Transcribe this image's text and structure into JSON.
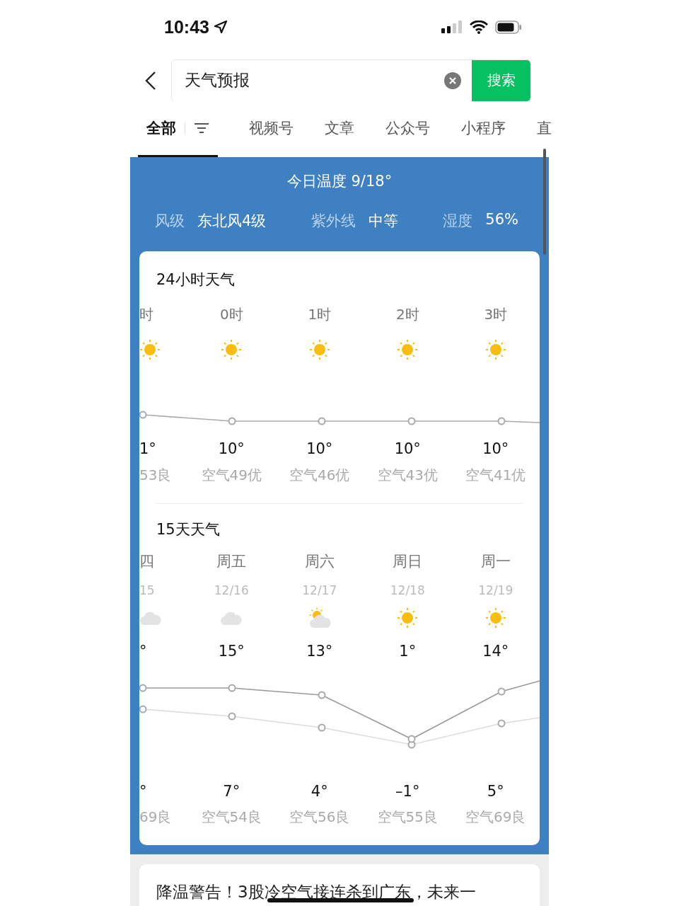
{
  "status_bar": {
    "time": "10:43"
  },
  "search": {
    "value": "天气预报",
    "button": "搜索"
  },
  "tabs": [
    {
      "label": "全部",
      "selected": true
    },
    {
      "label": "视频号",
      "selected": false
    },
    {
      "label": "文章",
      "selected": false
    },
    {
      "label": "公众号",
      "selected": false
    },
    {
      "label": "小程序",
      "selected": false
    },
    {
      "label": "直",
      "selected": false
    }
  ],
  "today": {
    "title": "今日温度 9/18°",
    "stats": [
      {
        "label": "风级",
        "value": "东北风4级"
      },
      {
        "label": "紫外线",
        "value": "中等"
      },
      {
        "label": "湿度",
        "value": "56%"
      }
    ]
  },
  "hourly": {
    "title": "24小时天气",
    "items": [
      {
        "time": "时",
        "kind": "sunny",
        "temp": "1°",
        "air": "53良"
      },
      {
        "time": "0时",
        "kind": "sunny",
        "temp": "10°",
        "air": "空气49优"
      },
      {
        "time": "1时",
        "kind": "sunny",
        "temp": "10°",
        "air": "空气46优"
      },
      {
        "time": "2时",
        "kind": "sunny",
        "temp": "10°",
        "air": "空气43优"
      },
      {
        "time": "3时",
        "kind": "sunny",
        "temp": "10°",
        "air": "空气41优"
      }
    ]
  },
  "daily": {
    "title": "15天天气",
    "items": [
      {
        "day": "四",
        "date": "15",
        "kind": "cloudy",
        "high": "°",
        "low": "°",
        "air": "69良"
      },
      {
        "day": "周五",
        "date": "12/16",
        "kind": "cloudy",
        "high": "15°",
        "low": "7°",
        "air": "空气54良"
      },
      {
        "day": "周六",
        "date": "12/17",
        "kind": "partly_cloudy",
        "high": "13°",
        "low": "4°",
        "air": "空气56良"
      },
      {
        "day": "周日",
        "date": "12/18",
        "kind": "sunny",
        "high": "1°",
        "low": "–1°",
        "air": "空气55良"
      },
      {
        "day": "周一",
        "date": "12/19",
        "kind": "sunny",
        "high": "14°",
        "low": "5°",
        "air": "空气69良"
      }
    ]
  },
  "article": {
    "title": "降温警告！3股冷空气接连杀到广东，未来一"
  }
}
